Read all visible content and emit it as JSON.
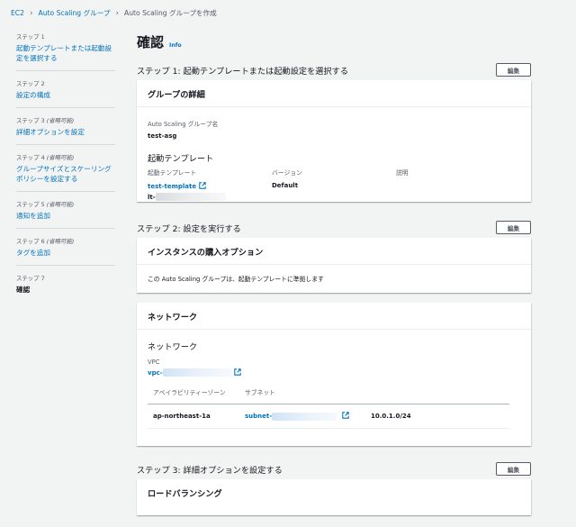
{
  "breadcrumb": {
    "ec2": "EC2",
    "asg": "Auto Scaling グループ",
    "current": "Auto Scaling グループを作成"
  },
  "steps": [
    {
      "num": "ステップ 1",
      "opt": "",
      "label": "起動テンプレートまたは起動設定を選択する"
    },
    {
      "num": "ステップ 2",
      "opt": "",
      "label": "設定の構成"
    },
    {
      "num": "ステップ 3",
      "opt": "(省略可能)",
      "label": "詳細オプションを設定"
    },
    {
      "num": "ステップ 4",
      "opt": "(省略可能)",
      "label": "グループサイズとスケーリングポリシーを設定する"
    },
    {
      "num": "ステップ 5",
      "opt": "(省略可能)",
      "label": "通知を追加"
    },
    {
      "num": "ステップ 6",
      "opt": "(省略可能)",
      "label": "タグを追加"
    },
    {
      "num": "ステップ 7",
      "opt": "",
      "label": "確認"
    }
  ],
  "page": {
    "title": "確認",
    "info": "Info"
  },
  "edit_label": "編集",
  "section1": {
    "title": "ステップ 1: 起動テンプレートまたは起動設定を選択する",
    "card_title": "グループの詳細",
    "asg_name_label": "Auto Scaling グループ名",
    "asg_name": "test-asg",
    "lt_heading": "起動テンプレート",
    "col_template": "起動テンプレート",
    "col_version": "バージョン",
    "col_description": "説明",
    "template_name": "test-template",
    "template_id_prefix": "lt-",
    "version": "Default"
  },
  "section2": {
    "title": "ステップ 2: 設定を実行する",
    "purchase_title": "インスタンスの購入オプション",
    "purchase_text": "この Auto Scaling グループは、起動テンプレートに準拠します",
    "network_title": "ネットワーク",
    "network_sub": "ネットワーク",
    "vpc_label": "VPC",
    "vpc_prefix": "vpc-",
    "col_az": "アベイラビリティーゾーン",
    "col_subnet": "サブネット",
    "row_az": "ap-northeast-1a",
    "row_subnet_prefix": "subnet-",
    "row_cidr": "10.0.1.0/24"
  },
  "section3": {
    "title": "ステップ 3: 詳細オプションを設定する",
    "card_title": "ロードバランシング"
  }
}
